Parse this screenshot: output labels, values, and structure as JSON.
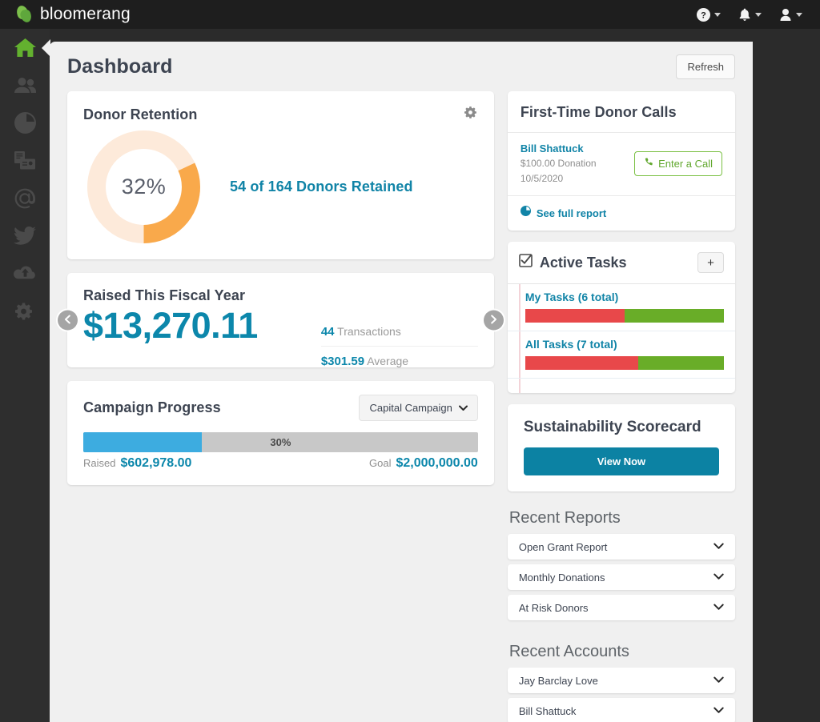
{
  "topbar": {
    "brand": "bloomerang",
    "logo_icon": "bloomerang-leaf-logo",
    "items": [
      {
        "icon": "help-circle-icon",
        "name": "help-menu"
      },
      {
        "icon": "bell-icon",
        "name": "notifications-menu"
      },
      {
        "icon": "user-icon",
        "name": "account-menu"
      }
    ]
  },
  "sidebar": {
    "items": [
      {
        "icon": "home-icon",
        "name": "sidebar-item-home",
        "active": true
      },
      {
        "icon": "people-icon",
        "name": "sidebar-item-constituents",
        "active": false
      },
      {
        "icon": "pie-chart-icon",
        "name": "sidebar-item-reports",
        "active": false
      },
      {
        "icon": "letters-icon",
        "name": "sidebar-item-letters",
        "active": false
      },
      {
        "icon": "at-sign-icon",
        "name": "sidebar-item-email",
        "active": false
      },
      {
        "icon": "twitter-bird-icon",
        "name": "sidebar-item-social",
        "active": false
      },
      {
        "icon": "cloud-upload-icon",
        "name": "sidebar-item-import",
        "active": false
      },
      {
        "icon": "gear-icon",
        "name": "sidebar-item-settings",
        "active": false
      }
    ]
  },
  "page": {
    "title": "Dashboard",
    "refresh_label": "Refresh"
  },
  "donor_retention": {
    "title": "Donor Retention",
    "gear_icon": "gear-icon",
    "percent_label": "32%",
    "percent_value": 32,
    "summary": "54 of 164 Donors Retained",
    "arc_color": "#f9a94b",
    "track_color": "#fdeada"
  },
  "raised": {
    "title": "Raised This Fiscal Year",
    "amount": "$13,270.11",
    "transactions_value": "44",
    "transactions_label": "Transactions",
    "average_value": "$301.59",
    "average_label": "Average",
    "prev_icon": "chevron-left-icon",
    "next_icon": "chevron-right-icon"
  },
  "campaign": {
    "title": "Campaign Progress",
    "selected": "Capital Campaign",
    "dropdown_icon": "chevron-down-icon",
    "percent_label": "30%",
    "percent_value": 30,
    "raised_label": "Raised",
    "raised_value": "$602,978.00",
    "goal_label": "Goal",
    "goal_value": "$2,000,000.00",
    "fill_color": "#3dace0"
  },
  "first_time_calls": {
    "title": "First-Time Donor Calls",
    "donor_name": "Bill Shattuck",
    "donation": "$100.00 Donation",
    "date": "10/5/2020",
    "call_button_label": "Enter a Call",
    "call_icon": "phone-icon",
    "report_link": "See full report",
    "report_icon": "pie-chart-icon"
  },
  "active_tasks": {
    "title": "Active Tasks",
    "check_icon": "checkbox-checked-icon",
    "add_label": "+",
    "rows": [
      {
        "label": "My Tasks (6 total)",
        "red_pct": 50,
        "green_pct": 50
      },
      {
        "label": "All Tasks (7 total)",
        "red_pct": 57,
        "green_pct": 43
      }
    ],
    "red_color": "#e8484a",
    "green_color": "#69ad28"
  },
  "scorecard": {
    "title": "Sustainability Scorecard",
    "button_label": "View Now",
    "button_color": "#0c82a3"
  },
  "recent_reports": {
    "heading": "Recent Reports",
    "items": [
      {
        "label": "Open Grant Report",
        "icon": "chevron-down-icon"
      },
      {
        "label": "Monthly Donations",
        "icon": "chevron-down-icon"
      },
      {
        "label": "At Risk Donors",
        "icon": "chevron-down-icon"
      }
    ]
  },
  "recent_accounts": {
    "heading": "Recent Accounts",
    "items": [
      {
        "label": "Jay Barclay Love",
        "icon": "chevron-down-icon"
      },
      {
        "label": "Bill Shattuck",
        "icon": "chevron-down-icon"
      }
    ]
  }
}
